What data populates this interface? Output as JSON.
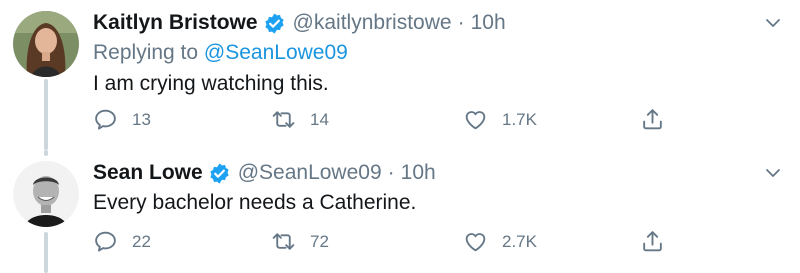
{
  "tweets": [
    {
      "name": "Kaitlyn Bristowe",
      "handle": "@kaitlynbristowe",
      "time": "10h",
      "replying_prefix": "Replying to",
      "replying_to": "@SeanLowe09",
      "text": "I am crying watching this.",
      "replies": "13",
      "retweets": "14",
      "likes": "1.7K"
    },
    {
      "name": "Sean Lowe",
      "handle": "@SeanLowe09",
      "time": "10h",
      "text": "Every bachelor needs a Catherine.",
      "replies": "22",
      "retweets": "72",
      "likes": "2.7K"
    }
  ],
  "separator": "·",
  "colors": {
    "link": "#1b95e0",
    "muted": "#657786",
    "thread_line": "#ccd6dd",
    "verified": "#1da1f2"
  },
  "icons": [
    "verified-badge-icon",
    "chevron-down-icon",
    "reply-icon",
    "retweet-icon",
    "like-icon",
    "share-icon"
  ]
}
